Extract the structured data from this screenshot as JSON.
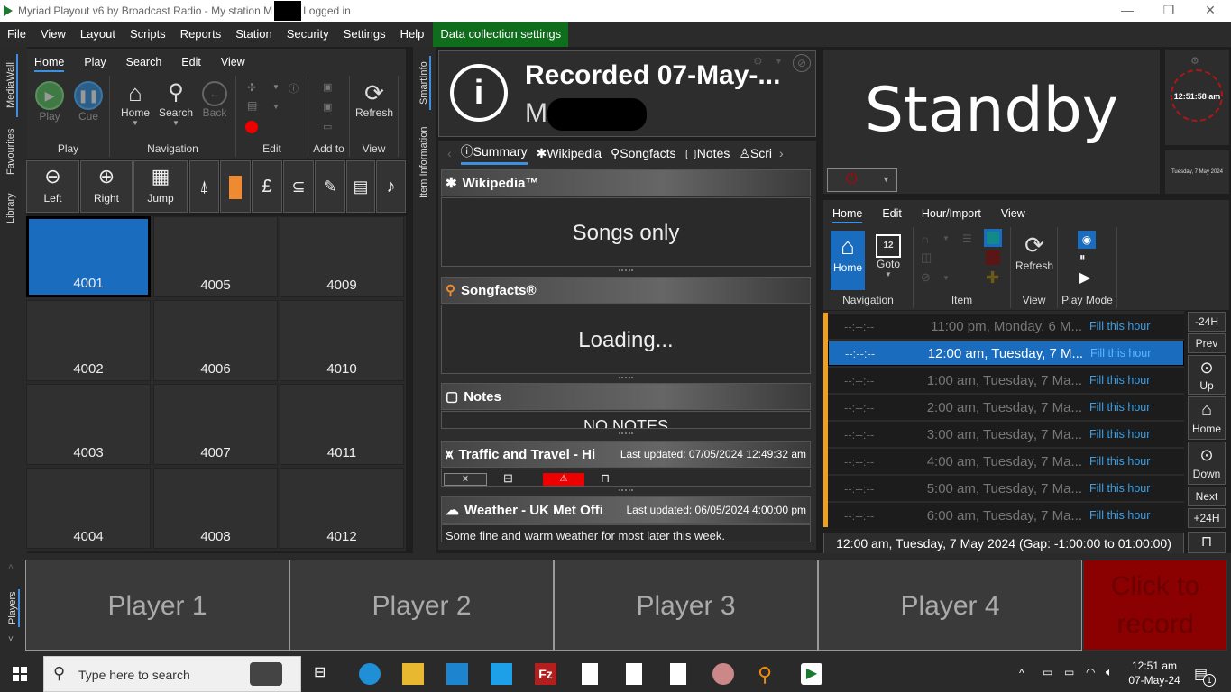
{
  "window": {
    "title_prefix": "Myriad Playout v6 by Broadcast Radio - My station M",
    "title_suffix": "Logged in",
    "minimize_label": "—",
    "restore_label": "❐",
    "close_label": "✕"
  },
  "menu": {
    "items": [
      "File",
      "View",
      "Layout",
      "Scripts",
      "Reports",
      "Station",
      "Security",
      "Settings",
      "Help"
    ],
    "highlight": "Data collection settings"
  },
  "left_vtabs": [
    "MediaWall",
    "Favourites",
    "Library"
  ],
  "mediawall": {
    "ribbon_tabs": [
      "Home",
      "Play",
      "Search",
      "Edit",
      "View"
    ],
    "active_tab": "Home",
    "groups": {
      "play": {
        "label": "Play",
        "play": "Play",
        "cue": "Cue"
      },
      "navigation": {
        "label": "Navigation",
        "home": "Home",
        "search": "Search",
        "back": "Back"
      },
      "edit": {
        "label": "Edit"
      },
      "addto": {
        "label": "Add to"
      },
      "view": {
        "label": "View",
        "refresh": "Refresh"
      }
    },
    "toolbar": {
      "left": "Left",
      "right": "Right",
      "jump": "Jump"
    },
    "cells": [
      "4001",
      "4005",
      "4009",
      "4002",
      "4006",
      "4010",
      "4003",
      "4007",
      "4011",
      "4004",
      "4008",
      "4012"
    ],
    "selected_cell": "4001"
  },
  "smartinfo": {
    "vtabs": [
      "SmartInfo",
      "Item Information"
    ],
    "title": "Recorded 07-May-...",
    "subtitle": "M",
    "tabs": [
      "Summary",
      "Wikipedia",
      "Songfacts",
      "Notes",
      "Scri"
    ],
    "active_tab": "Summary",
    "sections": {
      "wikipedia": {
        "title": "Wikipedia™",
        "body": "Songs only"
      },
      "songfacts": {
        "title": "Songfacts®",
        "body": "Loading..."
      },
      "notes": {
        "title": "Notes",
        "body": "No notes"
      },
      "traffic": {
        "title": "Traffic and Travel - Hi",
        "updated": "Last updated: 07/05/2024 12:49:32 am"
      },
      "weather": {
        "title": "Weather - UK Met Offi",
        "updated": "Last updated: 06/05/2024 4:00:00 pm",
        "body": "Some fine and warm weather for most later this week."
      }
    }
  },
  "status": {
    "mode": "Standby",
    "clock": "12:51:58 am",
    "date": "Tuesday, 7 May 2024"
  },
  "log": {
    "ribbon_tabs": [
      "Home",
      "Edit",
      "Hour/Import",
      "View"
    ],
    "active_tab": "Home",
    "groups": {
      "navigation": {
        "label": "Navigation",
        "home": "Home",
        "goto": "Goto"
      },
      "item": {
        "label": "Item"
      },
      "view": {
        "label": "View",
        "refresh": "Refresh"
      },
      "playmode": {
        "label": "Play Mode"
      }
    },
    "rows": [
      {
        "time": "--:--:--",
        "hour": "11:00 pm, Monday, 6 M...",
        "action": "Fill this hour"
      },
      {
        "time": "--:--:--",
        "hour": "12:00 am, Tuesday, 7 M...",
        "action": "Fill this hour"
      },
      {
        "time": "--:--:--",
        "hour": "1:00 am, Tuesday, 7 Ma...",
        "action": "Fill this hour"
      },
      {
        "time": "--:--:--",
        "hour": "2:00 am, Tuesday, 7 Ma...",
        "action": "Fill this hour"
      },
      {
        "time": "--:--:--",
        "hour": "3:00 am, Tuesday, 7 Ma...",
        "action": "Fill this hour"
      },
      {
        "time": "--:--:--",
        "hour": "4:00 am, Tuesday, 7 Ma...",
        "action": "Fill this hour"
      },
      {
        "time": "--:--:--",
        "hour": "5:00 am, Tuesday, 7 Ma...",
        "action": "Fill this hour"
      },
      {
        "time": "--:--:--",
        "hour": "6:00 am, Tuesday, 7 Ma...",
        "action": "Fill this hour"
      }
    ],
    "selected_row": 1,
    "footer": "12:00 am, Tuesday, 7 May 2024 (Gap: -1:00:00 to 01:00:00)",
    "nav": {
      "minus24": "-24H",
      "prev": "Prev",
      "up": "Up",
      "home": "Home",
      "down": "Down",
      "next": "Next",
      "plus24": "+24H"
    }
  },
  "players": {
    "vtab": "Players",
    "items": [
      "Player 1",
      "Player 2",
      "Player 3",
      "Player 4"
    ],
    "record": "Click to record"
  },
  "taskbar": {
    "search_placeholder": "Type here to search",
    "time": "12:51 am",
    "date": "07-May-24",
    "notifications": "1"
  },
  "colors": {
    "accent": "#1a6cbf",
    "record": "#8b0000",
    "menu_highlight": "#0f6e1b",
    "log_marker": "#f0a020"
  }
}
